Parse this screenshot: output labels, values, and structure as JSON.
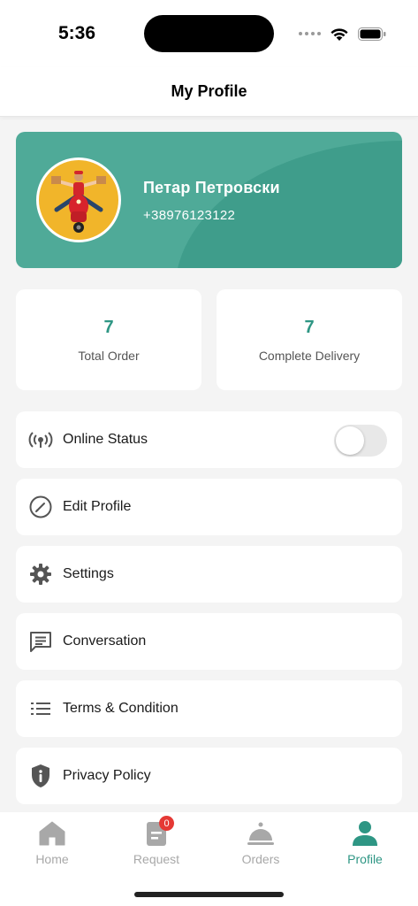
{
  "status_bar": {
    "time": "5:36"
  },
  "header": {
    "title": "My Profile"
  },
  "profile": {
    "name": "Петар Петровски",
    "phone": "+38976123122",
    "accent": "#4faa98"
  },
  "stats": [
    {
      "value": "7",
      "label": "Total Order"
    },
    {
      "value": "7",
      "label": "Complete Delivery"
    }
  ],
  "menu": {
    "online_status": {
      "label": "Online Status",
      "icon": "broadcast-icon",
      "enabled": false
    },
    "edit_profile": {
      "label": "Edit Profile",
      "icon": "edit-circle-icon"
    },
    "settings": {
      "label": "Settings",
      "icon": "gear-icon"
    },
    "conversation": {
      "label": "Conversation",
      "icon": "chat-icon"
    },
    "terms": {
      "label": "Terms & Condition",
      "icon": "list-icon"
    },
    "privacy": {
      "label": "Privacy Policy",
      "icon": "shield-info-icon"
    }
  },
  "bottom_nav": {
    "home": {
      "label": "Home",
      "icon": "home-icon"
    },
    "request": {
      "label": "Request",
      "icon": "document-icon",
      "badge": "0"
    },
    "orders": {
      "label": "Orders",
      "icon": "cloche-icon"
    },
    "profile": {
      "label": "Profile",
      "icon": "person-icon",
      "active": true
    }
  },
  "colors": {
    "primary": "#2e9684",
    "inactive": "#a8a8a8",
    "badge": "#e53935"
  }
}
